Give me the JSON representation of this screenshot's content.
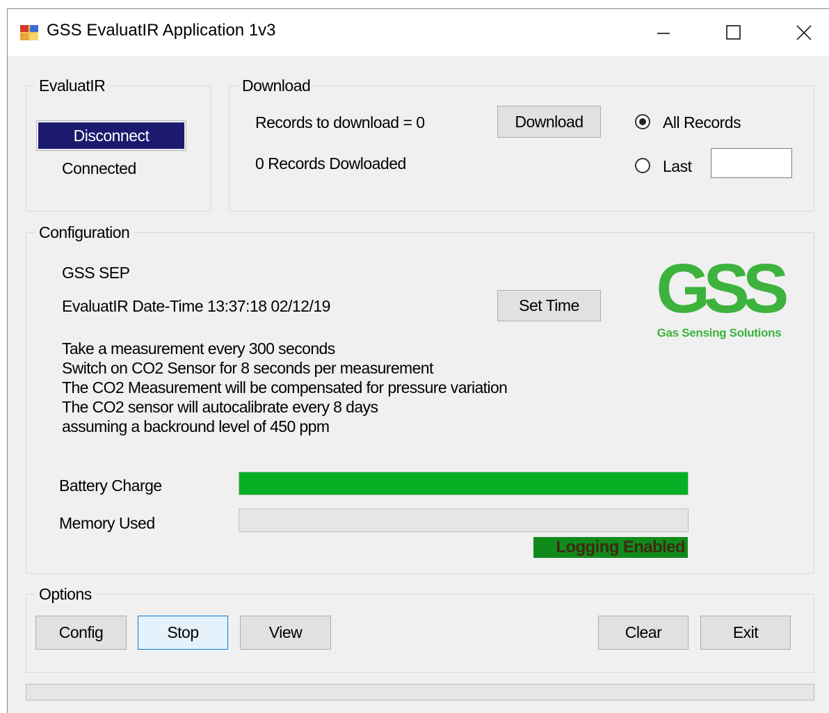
{
  "window": {
    "title": "GSS EvaluatIR Application 1v3"
  },
  "evaluatir_group": {
    "legend": "EvaluatIR",
    "disconnect_label": "Disconnect",
    "status": "Connected"
  },
  "download_group": {
    "legend": "Download",
    "records_to_download": "Records to download = 0",
    "records_downloaded": "0 Records Dowloaded",
    "download_label": "Download",
    "all_records_label": "All Records",
    "all_records_selected": true,
    "last_label": "Last",
    "last_value": ""
  },
  "configuration_group": {
    "legend": "Configuration",
    "device": "GSS SEP",
    "datetime": "EvaluatIR Date-Time 13:37:18 02/12/19",
    "set_time_label": "Set Time",
    "info_lines": [
      "Take a measurement every 300 seconds",
      "Switch on CO2 Sensor for 8 seconds per measurement",
      "The CO2 Measurement will be compensated for pressure variation",
      "The CO2 sensor will autocalibrate every 8 days",
      "assuming a backround level of 450 ppm"
    ],
    "battery_label": "Battery Charge",
    "battery_fraction": 1.0,
    "memory_label": "Memory Used",
    "memory_fraction": 0.0,
    "logging_status": "Logging Enabled",
    "logo": {
      "text": "GSS",
      "subtitle": "Gas Sensing Solutions",
      "color": "#3db33d"
    }
  },
  "options_group": {
    "legend": "Options",
    "config_label": "Config",
    "stop_label": "Stop",
    "view_label": "View",
    "clear_label": "Clear",
    "exit_label": "Exit"
  },
  "colors": {
    "progress_green": "#06b025",
    "button_dark": "#1c1a6e",
    "logging_badge": "#118a1c"
  }
}
